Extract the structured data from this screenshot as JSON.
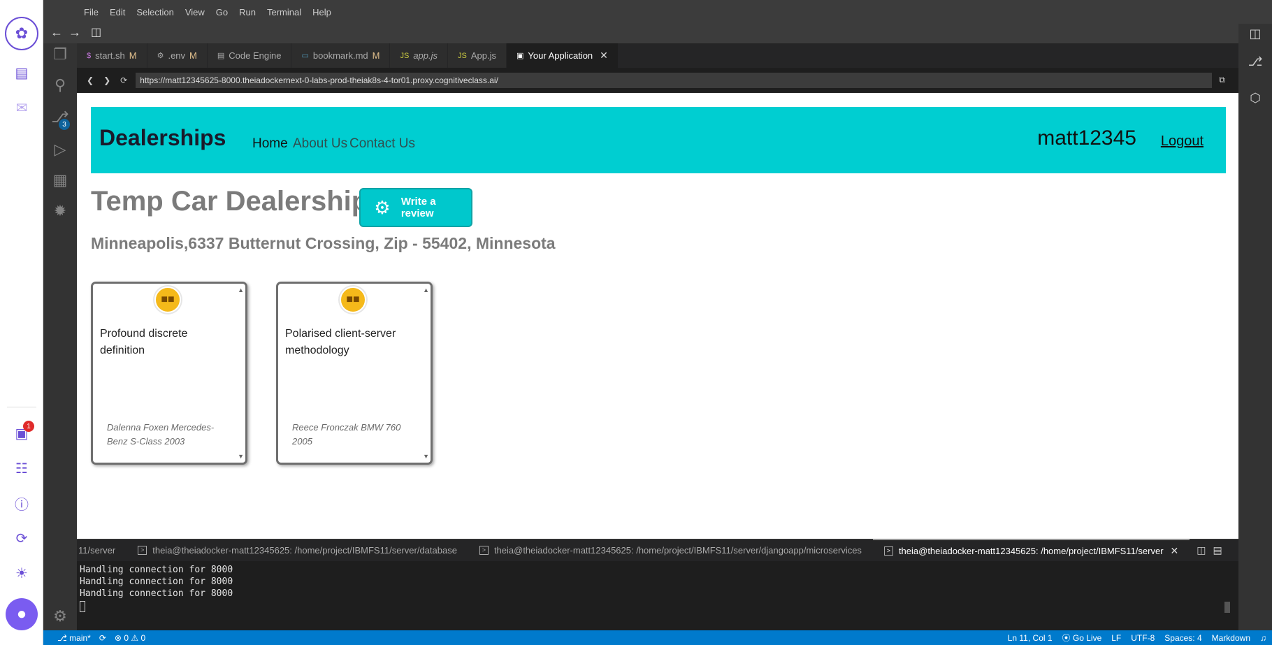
{
  "menu": [
    "File",
    "Edit",
    "Selection",
    "View",
    "Go",
    "Run",
    "Terminal",
    "Help"
  ],
  "outer_rail": {
    "inbox_badge": "1"
  },
  "activity": {
    "scm_badge": "3"
  },
  "tabs": [
    {
      "label": "start.sh",
      "icon": "$",
      "icon_color": "#c678dd",
      "modified": "M",
      "active": false
    },
    {
      "label": ".env",
      "icon": "⚙",
      "icon_color": "#aaaaaa",
      "modified": "M",
      "active": false
    },
    {
      "label": "Code Engine",
      "icon": "▤",
      "icon_color": "#aaaaaa",
      "modified": "",
      "active": false
    },
    {
      "label": "bookmark.md",
      "icon": "▭",
      "icon_color": "#519aba",
      "modified": "M",
      "active": false
    },
    {
      "label": "app.js",
      "icon": "JS",
      "icon_color": "#cbcb41",
      "modified": "",
      "active": false
    },
    {
      "label": "App.js",
      "icon": "JS",
      "icon_color": "#cbcb41",
      "modified": "",
      "active": false
    },
    {
      "label": "Your Application",
      "icon": "▣",
      "icon_color": "#ffffff",
      "modified": "",
      "active": true
    }
  ],
  "browser": {
    "url": "https://matt12345625-8000.theiadockernext-0-labs-prod-theiak8s-4-tor01.proxy.cognitiveclass.ai/"
  },
  "site": {
    "brand": "Dealerships",
    "nav": [
      "Home",
      "About Us",
      "Contact Us"
    ],
    "username": "matt12345",
    "logout": "Logout",
    "dealer_name": "Temp Car Dealership",
    "review_button": "Write a review",
    "address": "Minneapolis,6337 Butternut Crossing, Zip - 55402, Minnesota",
    "reviews": [
      {
        "text": "Profound discrete definition",
        "meta": "Dalenna Foxen Mercedes-Benz S-Class 2003",
        "sentiment_icon": "neutral-face-icon"
      },
      {
        "text": "Polarised client-server methodology",
        "meta": "Reece Fronczak BMW 760 2005",
        "sentiment_icon": "neutral-face-icon"
      }
    ]
  },
  "terminal": {
    "tabs": [
      "11/server",
      "theia@theiadocker-matt12345625: /home/project/IBMFS11/server/database",
      "theia@theiadocker-matt12345625: /home/project/IBMFS11/server/djangoapp/microservices",
      "theia@theiadocker-matt12345625: /home/project/IBMFS11/server"
    ],
    "lines": [
      "Handling connection for 8000",
      "Handling connection for 8000",
      "Handling connection for 8000"
    ]
  },
  "status": {
    "branch": "main*",
    "errors": "0",
    "warnings": "0",
    "position": "Ln 11, Col 1",
    "golive": "Go Live",
    "eol": "LF",
    "encoding": "UTF-8",
    "spaces": "Spaces: 4",
    "language": "Markdown"
  },
  "colors": {
    "accent": "#007acc",
    "site_nav": "#00ced1",
    "rail_accent": "#6b4fd6"
  }
}
